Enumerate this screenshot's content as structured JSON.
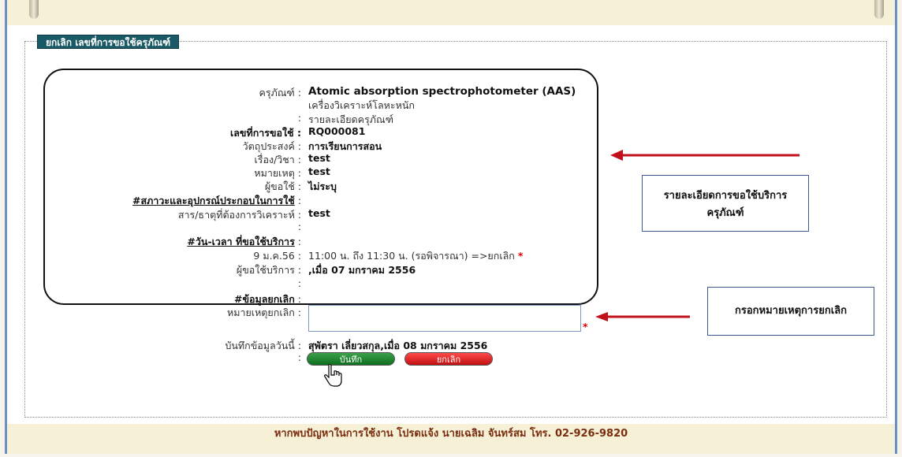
{
  "legend": "ยกเลิก เลขที่การขอใช้ครุภัณฑ์",
  "details": {
    "equipment_label": "ครุภัณฑ์ :",
    "equipment_name": "Atomic absorption spectrophotometer (AAS)",
    "equipment_thai": "เครื่องวิเคราะห์โลหะหนัก",
    "detail_sep": ":",
    "detail_link": "รายละเอียดครุภัณฑ์",
    "request_no_label": "เลขที่การขอใช้ :",
    "request_no": "RQ000081",
    "purpose_label": "วัตถุประสงค์ :",
    "purpose": "การเรียนการสอน",
    "subject_label": "เรื่อง/วิชา :",
    "subject": "test",
    "note_label": "หมายเหตุ :",
    "note": "test",
    "requester_label": "ผู้ขอใช้ :",
    "requester": "ไม่ระบุ",
    "conditions_heading": "#สภาวะและอุปกรณ์ประกอบในการใช้",
    "conditions_colon": ":",
    "substance_label": "สาร/ธาตุที่ต้องการวิเคราะห์ :",
    "substance": "test",
    "blank_colon": ":",
    "datetime_heading": "#วัน-เวลา ที่ขอใช้บริการ",
    "datetime_colon": ":",
    "date_label": "9 ม.ค.56 :",
    "date_value": "11:00 น. ถึง 11:30 น. (รอพิจารณา) =>ยกเลิก",
    "star": "*",
    "service_requester_label": "ผู้ขอใช้บริการ :",
    "service_requester": ",เมื่อ 07 มกราคม 2556"
  },
  "cancel": {
    "colon_only": ":",
    "heading": "#ข้อมูลยกเลิก",
    "heading_colon": ":",
    "reason_label": "หมายเหตุยกเลิก :",
    "reason_value": "",
    "required_star": "*",
    "record_label": "บันทึกข้อมูลวันนี้ :",
    "record_value": "สุพัตรา เลี่ยวสกุล,เมื่อ 08 มกราคม 2556",
    "buttons_colon": ":",
    "save_label": "บันทึก",
    "cancel_label": "ยกเลิก"
  },
  "callouts": {
    "detail_box_line1": "รายละเอียดการขอใช้บริการ",
    "detail_box_line2": "ครุภัณฑ์",
    "reason_box": "กรอกหมายเหตุการยกเลิก"
  },
  "footer": "หากพบปัญหาในการใช้งาน โปรดแจ้ง นายเฉลิม จันทร์สม โทร. 02-926-9820",
  "colors": {
    "legend_bg": "#1a5a66",
    "arrow_red": "#c0111b",
    "save_green": "#0f6f20",
    "cancel_red": "#c21010"
  }
}
